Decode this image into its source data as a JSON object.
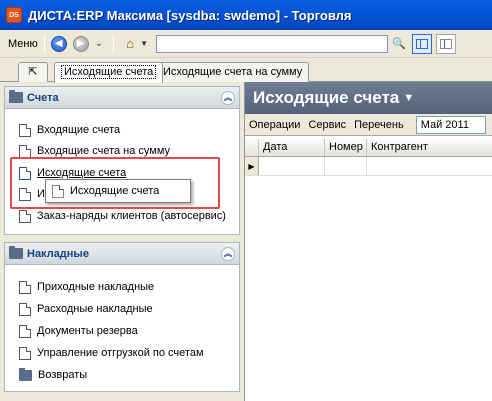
{
  "window": {
    "title": "ДИСТА:ERP Максима [sysdba: swdemo] - Торговля",
    "app_icon_text": "DS"
  },
  "toolbar": {
    "menu_label": "Меню",
    "address_value": "",
    "icons": [
      "back-icon",
      "forward-icon",
      "history-dropdown-icon",
      "home-icon",
      "search-icon",
      "view-panels-icon",
      "view-single-icon"
    ]
  },
  "tabs": [
    {
      "label": "Исходящие счета",
      "active": true
    },
    {
      "label": "Исходящие счета на сумму",
      "active": false
    }
  ],
  "groups": {
    "accounts": {
      "title": "Счета",
      "items": [
        {
          "label": "Входящие счета"
        },
        {
          "label": "Входящие счета на сумму"
        },
        {
          "label": "Исходящие счета"
        },
        {
          "label": "И"
        },
        {
          "label": "Заказ-наряды клиентов (автосервис)"
        }
      ]
    },
    "invoices": {
      "title": "Накладные",
      "items": [
        {
          "label": "Приходные накладные"
        },
        {
          "label": "Расходные накладные"
        },
        {
          "label": "Документы резерва"
        },
        {
          "label": "Управление отгрузкой по счетам"
        },
        {
          "label": "Возвраты"
        }
      ]
    }
  },
  "drag_ghost": {
    "label": "Исходящие счета"
  },
  "content": {
    "title": "Исходящие счета",
    "menu": [
      "Операции",
      "Сервис",
      "Перечень"
    ],
    "period": "Май 2011",
    "columns": [
      "Дата",
      "Номер",
      "Контрагент"
    ]
  },
  "colors": {
    "titlebar": "#0754d8",
    "content_header": "#5f6c83",
    "highlight": "#e0484a"
  }
}
